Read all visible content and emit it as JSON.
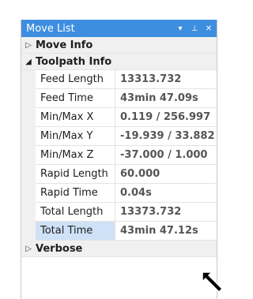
{
  "panel": {
    "title": "Move List",
    "pin_glyph": "▾",
    "pushpin_glyph": "⊥",
    "close_glyph": "✕"
  },
  "sections": {
    "move_info": {
      "label": "Move Info",
      "arrow": "▷"
    },
    "toolpath_info": {
      "label": "Toolpath Info",
      "arrow": "◢"
    },
    "verbose": {
      "label": "Verbose",
      "arrow": "▷"
    }
  },
  "rows": [
    {
      "name": "Feed Length",
      "value": "13313.732"
    },
    {
      "name": "Feed Time",
      "value": "43min 47.09s"
    },
    {
      "name": "Min/Max X",
      "value": "0.119 / 256.997"
    },
    {
      "name": "Min/Max Y",
      "value": "-19.939 / 33.882"
    },
    {
      "name": "Min/Max Z",
      "value": "-37.000 / 1.000"
    },
    {
      "name": "Rapid Length",
      "value": "60.000"
    },
    {
      "name": "Rapid Time",
      "value": "0.04s"
    },
    {
      "name": "Total Length",
      "value": "13373.732"
    },
    {
      "name": "Total Time",
      "value": "43min 47.12s"
    }
  ],
  "colors": {
    "titlebar": "#3e8ee0",
    "selected_row": "#cfe1f6",
    "value_text": "#555555"
  },
  "cursor_icon": "arrow-cursor-icon"
}
